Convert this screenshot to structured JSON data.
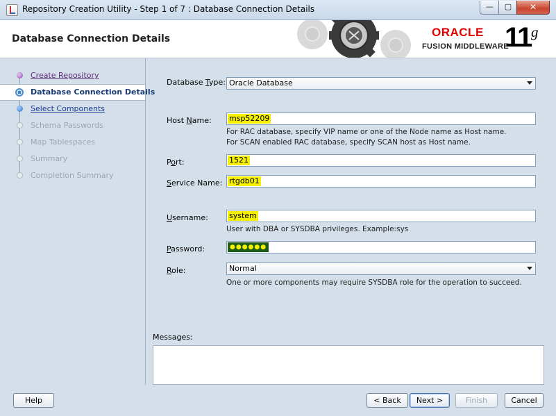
{
  "window": {
    "title": "Repository Creation Utility - Step 1 of 7 : Database Connection Details",
    "minimize_glyph": "—",
    "maximize_glyph": "▢",
    "close_glyph": "✕",
    "app_icon": "java-cup-icon"
  },
  "header": {
    "title": "Database Connection Details",
    "brand_oracle": "ORACLE",
    "brand_fusion": "FUSION MIDDLEWARE",
    "version_number": "11",
    "version_suffix": "g",
    "colors": {
      "oracle_red": "#e00000"
    }
  },
  "nav": {
    "items": [
      {
        "label": "Create Repository",
        "state": "done"
      },
      {
        "label": "Database Connection Details",
        "state": "current"
      },
      {
        "label": "Select Components",
        "state": "link"
      },
      {
        "label": "Schema Passwords",
        "state": "disabled"
      },
      {
        "label": "Map Tablespaces",
        "state": "disabled"
      },
      {
        "label": "Summary",
        "state": "disabled"
      },
      {
        "label": "Completion Summary",
        "state": "disabled"
      }
    ]
  },
  "form": {
    "database_type": {
      "label_pre": "Database ",
      "label_u": "T",
      "label_post": "ype:",
      "value": "Oracle Database"
    },
    "host_name": {
      "label_pre": "Host ",
      "label_u": "N",
      "label_post": "ame:",
      "value": "msp52209",
      "hint1": "For RAC database, specify VIP name or one of the Node name as Host name.",
      "hint2": "For SCAN enabled RAC database, specify SCAN host as Host name."
    },
    "port": {
      "label_pre": "P",
      "label_u": "o",
      "label_post": "rt:",
      "value": "1521"
    },
    "service_name": {
      "label_pre": "",
      "label_u": "S",
      "label_post": "ervice Name:",
      "value": "rtgdb01"
    },
    "username": {
      "label_pre": "",
      "label_u": "U",
      "label_post": "sername:",
      "value": "system",
      "hint": "User with DBA or SYSDBA privileges. Example:sys"
    },
    "password": {
      "label_pre": "",
      "label_u": "P",
      "label_post": "assword:",
      "value": "●●●●●●"
    },
    "role": {
      "label_pre": "",
      "label_u": "R",
      "label_post": "ole:",
      "value": "Normal",
      "hint": "One or more components may require SYSDBA role for the operation to succeed."
    },
    "highlight_color": "#f5f000"
  },
  "messages": {
    "label": "Messages:",
    "text": ""
  },
  "buttons": {
    "help": "Help",
    "back": "< Back",
    "next": "Next >",
    "finish": "Finish",
    "cancel": "Cancel"
  }
}
